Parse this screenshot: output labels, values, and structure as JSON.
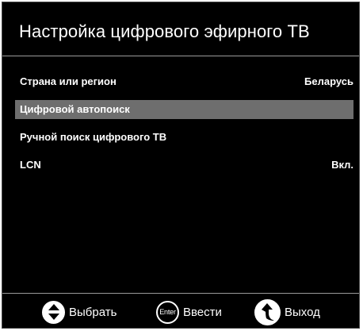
{
  "header": {
    "title": "Настройка цифрового эфирного ТВ"
  },
  "menu": {
    "items": [
      {
        "label": "Страна или регион",
        "value": "Беларусь",
        "selected": false
      },
      {
        "label": "Цифровой автопоиск",
        "value": "",
        "selected": true
      },
      {
        "label": "Ручной поиск цифрового ТВ",
        "value": "",
        "selected": false
      },
      {
        "label": "LCN",
        "value": "Вкл.",
        "selected": false
      }
    ]
  },
  "footer": {
    "select": {
      "icon": "up-down-arrows-icon",
      "label": "Выбрать"
    },
    "enter": {
      "icon": "enter-icon",
      "icon_text": "Enter",
      "label": "Ввести"
    },
    "exit": {
      "icon": "return-arrow-icon",
      "label": "Выход"
    }
  },
  "colors": {
    "background": "#000000",
    "text": "#ffffff",
    "selection": "#6e6e6e",
    "divider": "#9a9a9a"
  }
}
